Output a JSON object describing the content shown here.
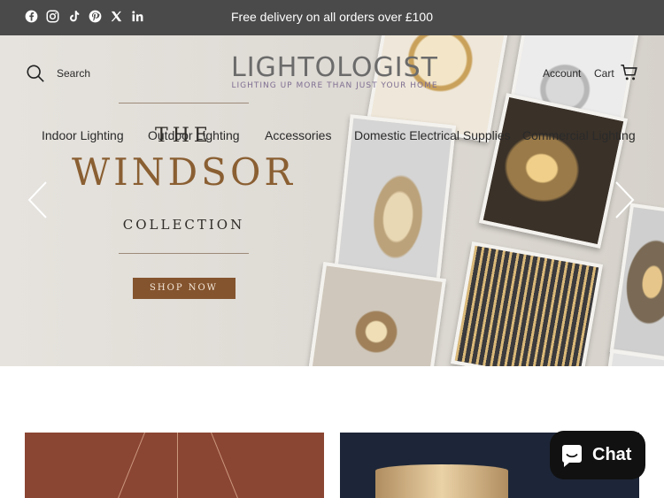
{
  "topbar": {
    "announcement": "Free delivery on all orders over £100",
    "social": [
      "facebook-icon",
      "instagram-icon",
      "tiktok-icon",
      "pinterest-icon",
      "x-icon",
      "linkedin-icon"
    ]
  },
  "header": {
    "search_label": "Search",
    "logo": {
      "word": "LIGHTOLOGIST",
      "tagline": "LIGHTING UP MORE THAN JUST YOUR HOME"
    },
    "account_label": "Account",
    "cart_label": "Cart"
  },
  "nav": {
    "items": [
      "Indoor Lighting",
      "Outdoor Lighting",
      "Accessories",
      "Domestic Electrical Supplies",
      "Commercial Lighting"
    ]
  },
  "hero": {
    "the": "THE",
    "title": "WINDSOR",
    "subtitle": "COLLECTION",
    "cta": "SHOP NOW"
  },
  "chat": {
    "label": "Chat"
  },
  "colors": {
    "topbar": "#4a4a4a",
    "accent_gold": "#8a5f32",
    "cta_bg": "#84542e",
    "tile_left": "#8b4533",
    "tile_right": "#1d2638"
  }
}
